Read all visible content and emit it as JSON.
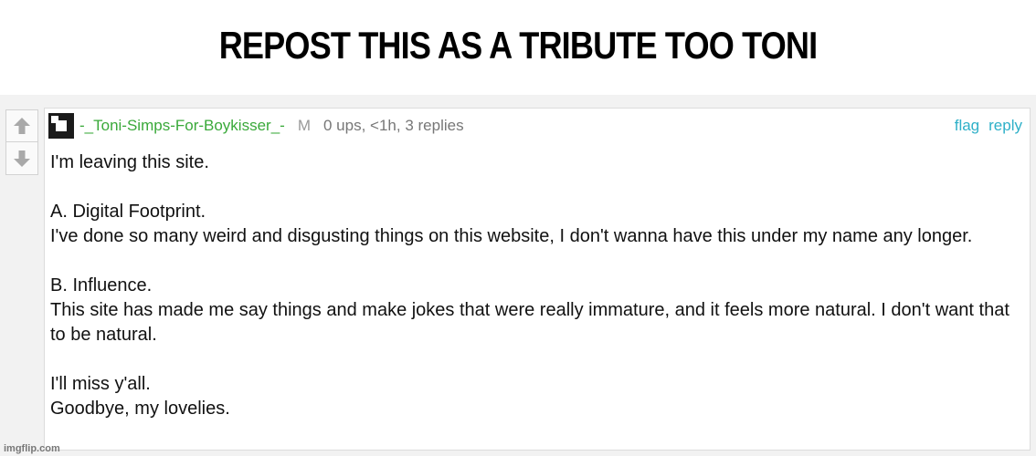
{
  "meme": {
    "caption": "REPOST THIS AS A TRIBUTE TOO TONI"
  },
  "comment": {
    "username": "-_Toni-Simps-For-Boykisser_-",
    "badge": "M",
    "stats": "0 ups, <1h, 3 replies",
    "flag_label": "flag",
    "reply_label": "reply",
    "upvote_icon": "arrow-up-icon",
    "downvote_icon": "arrow-down-icon",
    "paragraphs": [
      [
        "I'm leaving this site."
      ],
      [
        "A. Digital Footprint.",
        "I've done so many weird and disgusting things on this website, I don't wanna have this under my name any longer."
      ],
      [
        "B. Influence.",
        "This site has made me say things and make jokes that were really immature, and it feels more natural. I don't want that to be natural."
      ],
      [
        "I'll miss y'all.",
        "Goodbye, my lovelies."
      ]
    ]
  },
  "watermark": "imgflip.com"
}
